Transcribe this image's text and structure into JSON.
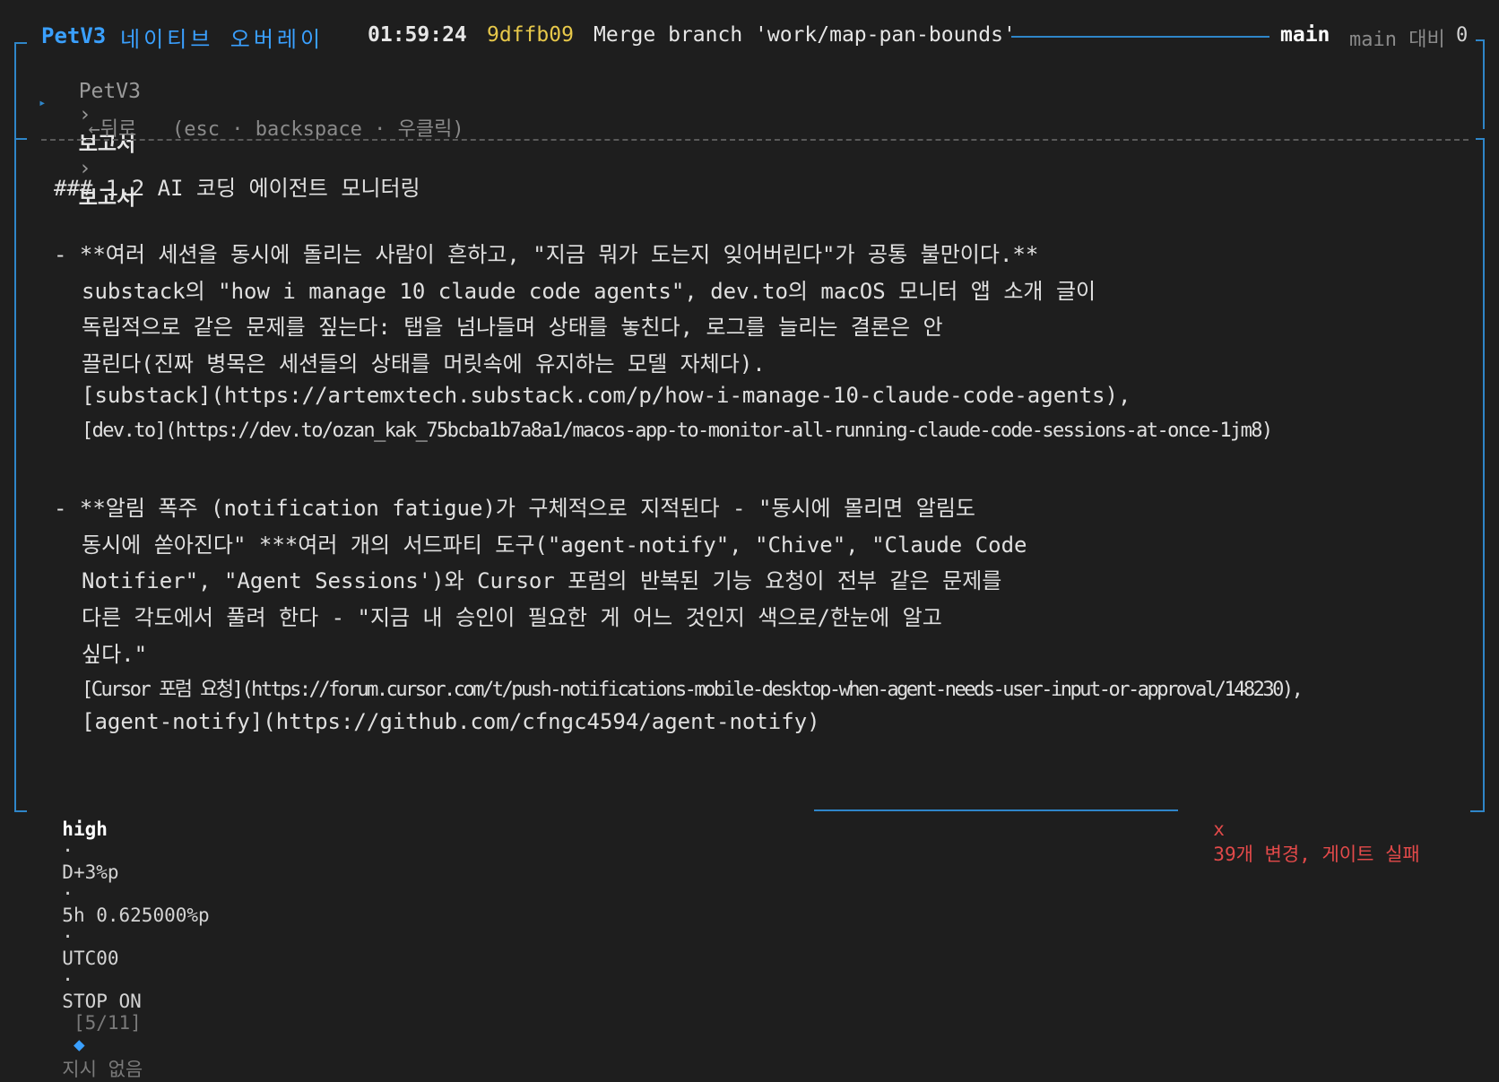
{
  "header": {
    "app_name": "PetV3",
    "workspace": "네이티브 오버레이",
    "time": "01:59:24",
    "commit_hash": "9dffb09",
    "commit_message": "Merge branch 'work/map-pan-bounds'",
    "branch": "main",
    "compare_label": "main 대비",
    "compare_count": "0"
  },
  "breadcrumb": {
    "root": "PetV3",
    "sep": "›",
    "level1": "보고서",
    "level2": "보고서"
  },
  "back": {
    "arrow": "▸",
    "label": "←뒤로",
    "hint": "(esc · backspace · 우클릭)"
  },
  "content": {
    "heading": "### 1.2 AI 코딩 에이전트 모니터링",
    "item1": {
      "l1": "- **여러 세션을 동시에 돌리는 사람이 흔하고, \"지금 뭐가 도는지 잊어버린다\"가 공통 불만이다.**",
      "l2": "substack의 \"how i manage 10 claude code agents\", dev.to의 macOS 모니터 앱 소개 글이",
      "l3": "독립적으로 같은 문제를 짚는다: 탭을 넘나들며 상태를 놓친다, 로그를 늘리는 결론은 안",
      "l4": "끌린다(진짜 병목은 세션들의 상태를 머릿속에 유지하는 모델 자체다).",
      "l5": "[substack](https://artemxtech.substack.com/p/how-i-manage-10-claude-code-agents),",
      "l6": "[dev.to](https://dev.to/ozan_kak_75bcba1b7a8a1/macos-app-to-monitor-all-running-claude-code-sessions-at-once-1jm8)"
    },
    "item2": {
      "l1": "- **알림 폭주 (notification fatigue)가 구체적으로 지적된다 - \"동시에 몰리면 알림도",
      "l2": "동시에 쏟아진다\" ***여러 개의 서드파티 도구(\"agent-notify\", \"Chive\", \"Claude Code",
      "l3": "Notifier\", \"Agent Sessions')와 Cursor 포럼의 반복된 기능 요청이 전부 같은 문제를",
      "l4": "다른 각도에서 풀려 한다 - \"지금 내 승인이 필요한 게 어느 것인지 색으로/한눈에 알고",
      "l5": "싶다.\"",
      "l6": "[Cursor 포럼 요청](https://forum.cursor.com/t/push-notifications-mobile-desktop-when-agent-needs-user-input-or-approval/148230),",
      "l7": "[agent-notify](https://github.com/cfngc4594/agent-notify)"
    }
  },
  "footer": {
    "effort": "high",
    "sep": "·",
    "delta": "D+3%p",
    "rate": "5h 0.625000%p",
    "tz": "UTC00",
    "stop": "STOP ON",
    "page": "[5/11]",
    "diamond": "◆",
    "instruction": "지시 없음",
    "error_mark": "x",
    "error_text": "39개 변경, 게이트 실패"
  },
  "colors": {
    "accent": "#3aa0ff",
    "frame": "#2f86c9",
    "hash": "#e7c84a",
    "error": "#e34a4a",
    "background": "#1e1e1e"
  }
}
